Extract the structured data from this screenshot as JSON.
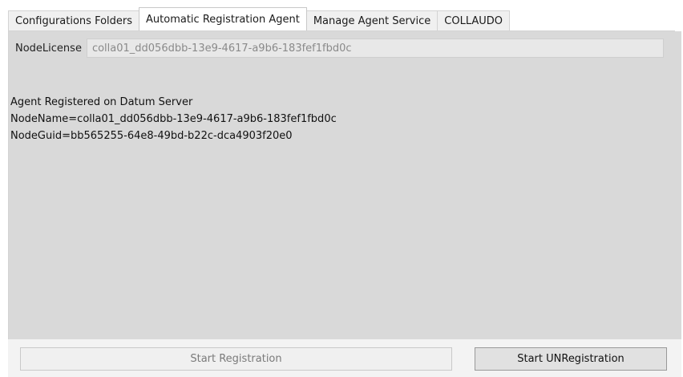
{
  "tabs": [
    {
      "label": "Configurations Folders",
      "active": false
    },
    {
      "label": "Automatic Registration Agent",
      "active": true
    },
    {
      "label": "Manage Agent Service",
      "active": false
    },
    {
      "label": "COLLAUDO",
      "active": false
    }
  ],
  "license": {
    "label": "NodeLicense",
    "value": "colla01_dd056dbb-13e9-4617-a9b6-183fef1fbd0c"
  },
  "status": {
    "line1": "Agent Registered on Datum Server",
    "line2": "NodeName=colla01_dd056dbb-13e9-4617-a9b6-183fef1fbd0c",
    "line3": "NodeGuid=bb565255-64e8-49bd-b22c-dca4903f20e0"
  },
  "buttons": {
    "start_registration": "Start Registration",
    "start_unregistration": "Start UNRegistration"
  },
  "colors": {
    "panel_bg": "#d9d9d9",
    "disabled_text": "#7a7a7a"
  }
}
